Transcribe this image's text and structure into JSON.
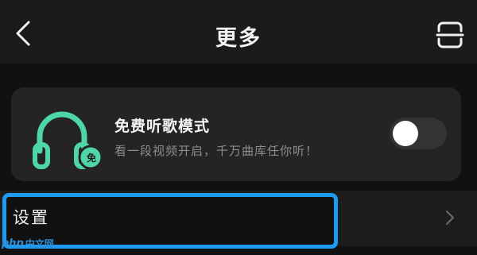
{
  "header": {
    "title": "更多",
    "back_icon": "chevron-left-icon",
    "scan_icon": "scan-icon"
  },
  "promo": {
    "title": "免费听歌模式",
    "subtitle": "看一段视频开启，千万曲库任你听！",
    "icon": "headphones-icon",
    "badge_text": "免",
    "accent_color": "#4fd6a6",
    "toggle_on": false
  },
  "settings": {
    "label": "设置",
    "highlight_color": "#1d9bf0"
  },
  "watermark": {
    "brand": "php",
    "site": "中文网"
  }
}
